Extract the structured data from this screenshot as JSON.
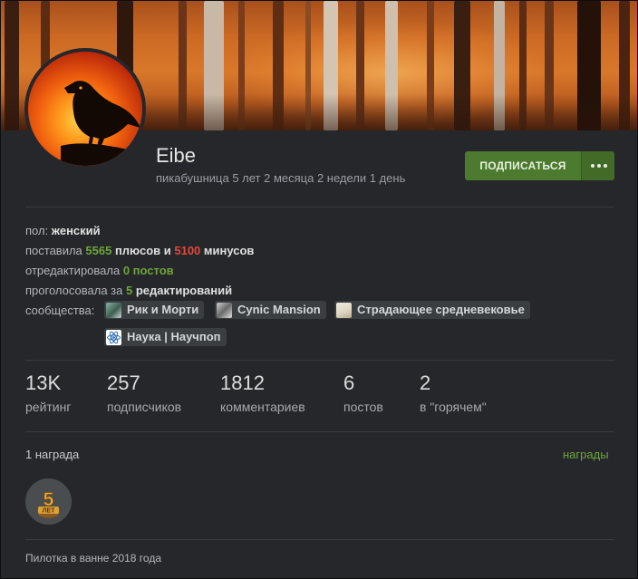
{
  "profile": {
    "username": "Eibe",
    "member_since": "пикабушница 5 лет 2 месяца 2 недели 1 день",
    "subscribe_label": "ПОДПИСАТЬСЯ",
    "more_icon": "more-dots-icon"
  },
  "info": {
    "gender_label": "пол: ",
    "gender_value": "женский",
    "rated_prefix": "поставила ",
    "plus_count": "5565",
    "plus_word": " плюсов и ",
    "minus_count": "5100",
    "minus_word": " минусов",
    "edited_prefix": "отредактировала ",
    "edited_value": "0 постов",
    "voted_prefix": "проголосовала за ",
    "voted_count": "5",
    "voted_word": " редактирований",
    "communities_label": "сообщества:",
    "communities": [
      {
        "name": "Рик и Морти",
        "icon": "rick-and-morty-icon"
      },
      {
        "name": "Cynic Mansion",
        "icon": "cynic-mansion-icon"
      },
      {
        "name": "Страдающее средневековье",
        "icon": "medieval-icon"
      },
      {
        "name": "Наука | Научпоп",
        "icon": "atom-icon"
      }
    ]
  },
  "stats": [
    {
      "value": "13K",
      "label": "рейтинг"
    },
    {
      "value": "257",
      "label": "подписчиков"
    },
    {
      "value": "1812",
      "label": "комментариев"
    },
    {
      "value": "6",
      "label": "постов"
    },
    {
      "value": "2",
      "label": "в \"горячем\""
    }
  ],
  "awards": {
    "title": "1 награда",
    "link": "награды",
    "badge_text": "5",
    "badge_sub": "ЛЕТ",
    "badge_icon": "five-years-badge-icon"
  },
  "footer": {
    "text": "Пилотка в ванне 2018 года"
  },
  "colors": {
    "accent_green": "#6fa53a",
    "minus_red": "#e5473a",
    "button_green": "#4c7a2e",
    "background": "#25272a"
  }
}
